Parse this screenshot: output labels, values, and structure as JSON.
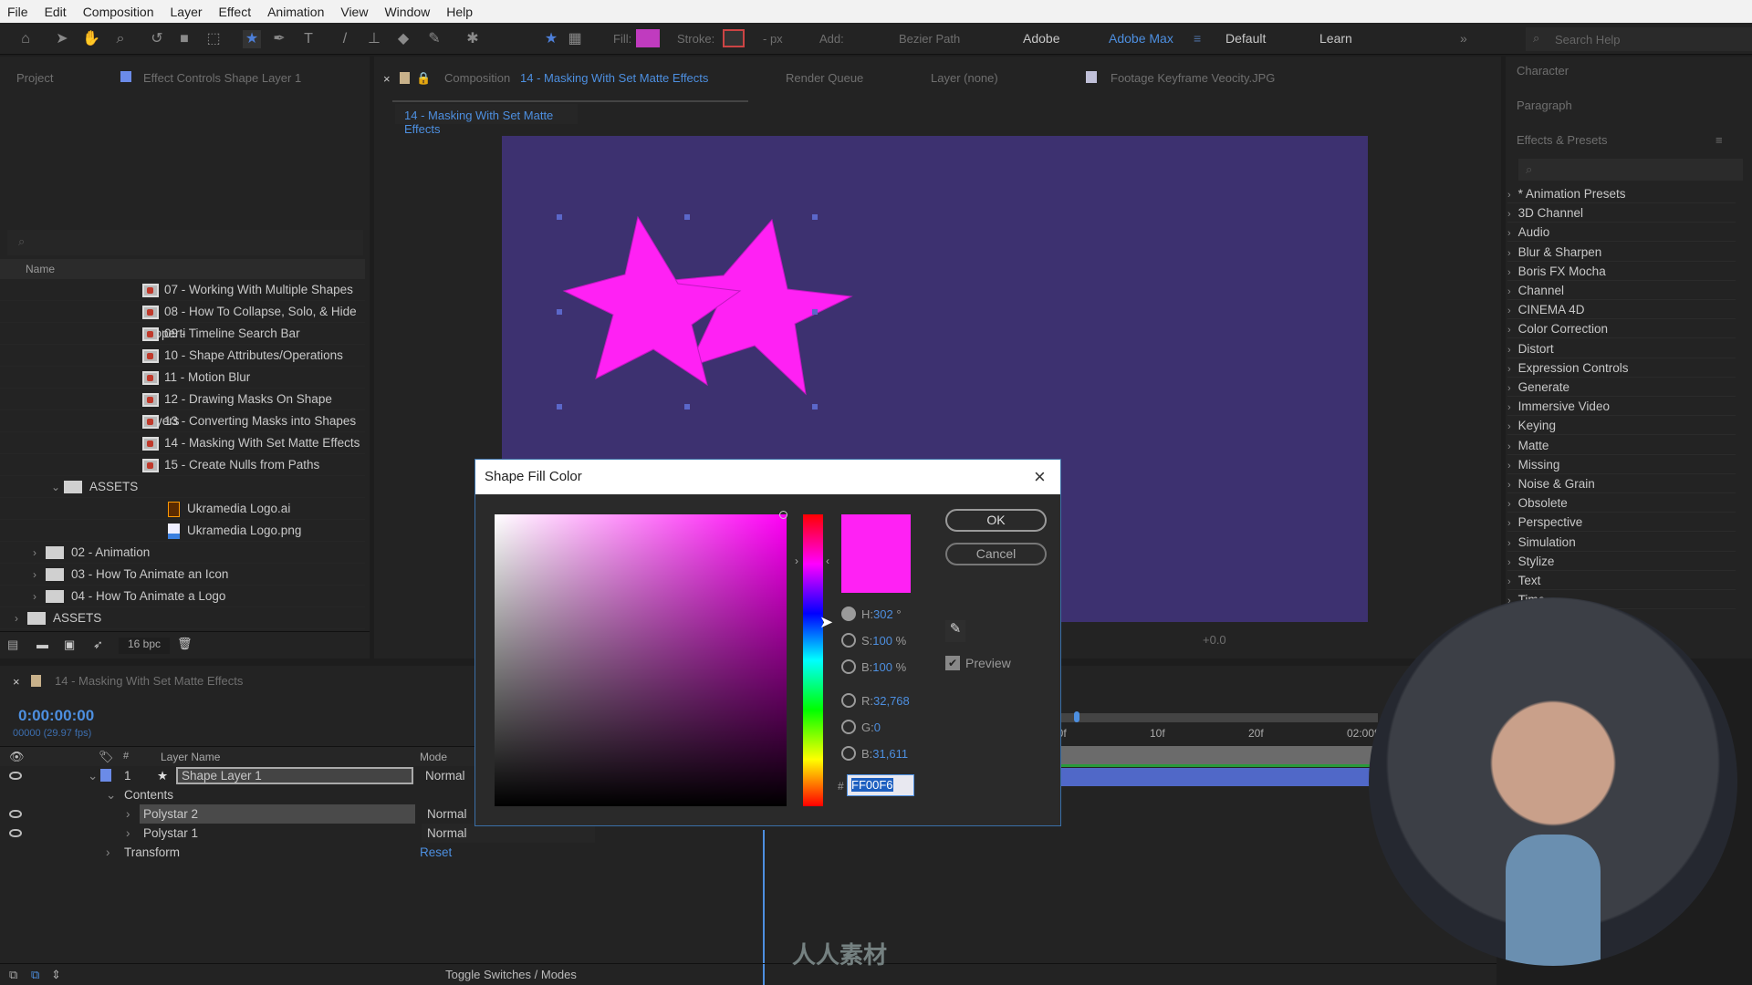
{
  "menu": [
    "File",
    "Edit",
    "Composition",
    "Layer",
    "Effect",
    "Animation",
    "View",
    "Window",
    "Help"
  ],
  "toolbar": {
    "fill_label": "Fill:",
    "fill_color": "#c03bbf",
    "stroke_label": "Stroke:",
    "stroke_px": "- px",
    "add_label": "Add:",
    "bezier_label": "Bezier Path",
    "workspaces": [
      "Adobe",
      "Adobe Max",
      "Default",
      "Learn"
    ],
    "active_workspace": "Adobe Max",
    "search_placeholder": "Search Help"
  },
  "left_panel": {
    "tabs": [
      "Project",
      "Effect Controls Shape Layer 1"
    ],
    "name_header": "Name",
    "items": [
      {
        "label": "07 - Working With Multiple Shapes",
        "type": "comp",
        "indent": 3
      },
      {
        "label": "08 - How To Collapse, Solo, & Hide Properti",
        "type": "comp",
        "indent": 3
      },
      {
        "label": "09 - Timeline Search Bar",
        "type": "comp",
        "indent": 3
      },
      {
        "label": "10 - Shape Attributes/Operations",
        "type": "comp",
        "indent": 3
      },
      {
        "label": "11 - Motion Blur",
        "type": "comp",
        "indent": 3
      },
      {
        "label": "12 - Drawing Masks On Shape Layers",
        "type": "comp",
        "indent": 3
      },
      {
        "label": "13 - Converting Masks into Shapes",
        "type": "comp",
        "indent": 3
      },
      {
        "label": "14 - Masking With Set Matte Effects",
        "type": "comp",
        "indent": 3
      },
      {
        "label": "15 - Create Nulls from Paths",
        "type": "comp",
        "indent": 3
      },
      {
        "label": "ASSETS",
        "type": "folder-open",
        "indent": 2
      },
      {
        "label": "Ukramedia Logo.ai",
        "type": "ai",
        "indent": 4
      },
      {
        "label": "Ukramedia Logo.png",
        "type": "png",
        "indent": 4
      },
      {
        "label": "02 - Animation",
        "type": "folder",
        "indent": 1
      },
      {
        "label": "03 - How To Animate an Icon",
        "type": "folder",
        "indent": 1
      },
      {
        "label": "04 - How To Animate a Logo",
        "type": "folder",
        "indent": 1
      },
      {
        "label": "ASSETS",
        "type": "folder",
        "indent": 0
      }
    ],
    "bpc": "16 bpc"
  },
  "comp_panel": {
    "tab_prefix": "Composition",
    "tab_name": "14 - Masking With Set Matte Effects",
    "other_tabs": [
      "Render Queue",
      "Layer (none)",
      "Footage Keyframe Veocity.JPG"
    ],
    "breadcrumb": "14 - Masking With Set Matte Effects",
    "canvas_color": "#3d3170",
    "star_color": "#ff21f4",
    "exposure": "+0.0"
  },
  "right_panel": {
    "character": "Character",
    "paragraph": "Paragraph",
    "effects_title": "Effects & Presets",
    "effects": [
      "* Animation Presets",
      "3D Channel",
      "Audio",
      "Blur & Sharpen",
      "Boris FX Mocha",
      "Channel",
      "CINEMA 4D",
      "Color Correction",
      "Distort",
      "Expression Controls",
      "Generate",
      "Immersive Video",
      "Keying",
      "Matte",
      "Missing",
      "Noise & Grain",
      "Obsolete",
      "Perspective",
      "Simulation",
      "Stylize",
      "Text",
      "Time"
    ]
  },
  "timeline": {
    "tab": "14 - Masking With Set Matte Effects",
    "timecode": "0:00:00:00",
    "frames": "00000 (29.97 fps)",
    "headers": {
      "name": "Layer Name",
      "mode": "Mode",
      "num": "#"
    },
    "layers": [
      {
        "num": "1",
        "name": "Shape Layer 1",
        "mode": "Normal"
      },
      {
        "name": "Contents"
      },
      {
        "name": "Polystar 2",
        "mode": "Normal"
      },
      {
        "name": "Polystar 1",
        "mode": "Normal"
      },
      {
        "name": "Transform",
        "mode": "Reset"
      }
    ],
    "ruler": [
      "00f",
      "10f",
      "20f",
      "02:00f"
    ],
    "toggle": "Toggle Switches / Modes"
  },
  "dialog": {
    "title": "Shape Fill Color",
    "ok": "OK",
    "cancel": "Cancel",
    "preview": "Preview",
    "preview_checked": true,
    "fields": [
      {
        "label": "H:",
        "value": "302",
        "unit": "°",
        "selected": true
      },
      {
        "label": "S:",
        "value": "100",
        "unit": "%"
      },
      {
        "label": "B:",
        "value": "100",
        "unit": "%"
      },
      {
        "label": "R:",
        "value": "32,768"
      },
      {
        "label": "G:",
        "value": "0"
      },
      {
        "label": "B:",
        "value": "31,611"
      }
    ],
    "hex_label": "#",
    "hex": "FF00F6",
    "color": "#ff00f6"
  },
  "watermark": "人人素材"
}
